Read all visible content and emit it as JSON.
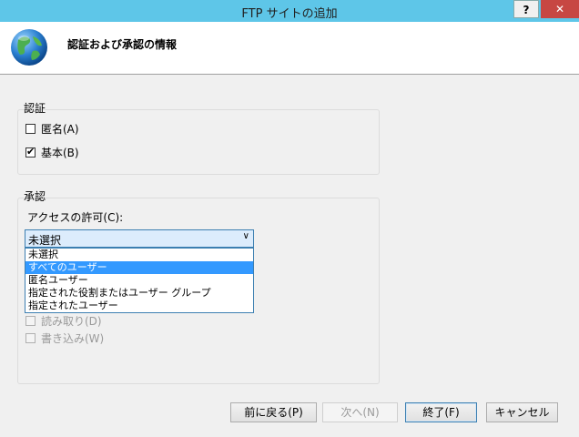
{
  "window": {
    "title": "FTP サイトの追加",
    "help": "?",
    "close": "✕"
  },
  "header": {
    "title": "認証および承認の情報"
  },
  "auth": {
    "label": "認証",
    "anonymous": {
      "label": "匿名(A)",
      "checked": false
    },
    "basic": {
      "label": "基本(B)",
      "checked": true
    }
  },
  "authorization": {
    "label": "承認",
    "access_label": "アクセスの許可(C):",
    "selected": "未選択",
    "options": [
      "未選択",
      "すべてのユーザー",
      "匿名ユーザー",
      "指定された役割またはユーザー グループ",
      "指定されたユーザー"
    ],
    "highlighted_index": 1,
    "permissions": {
      "read": "読み取り(D)",
      "write": "書き込み(W)"
    }
  },
  "buttons": {
    "back": "前に戻る(P)",
    "next": "次へ(N)",
    "finish": "終了(F)",
    "cancel": "キャンセル"
  }
}
